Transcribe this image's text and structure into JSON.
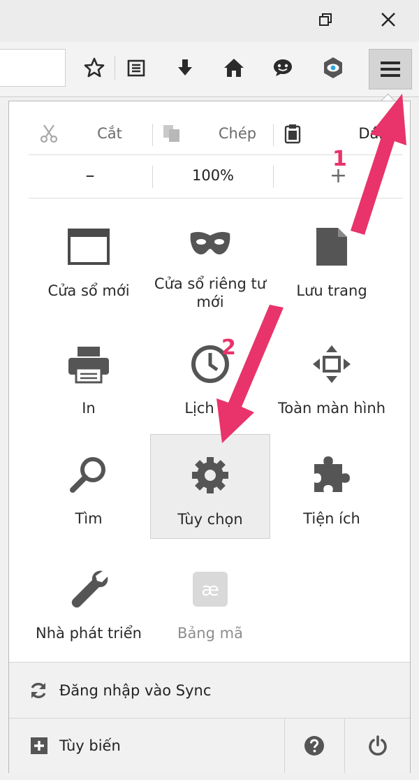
{
  "window": {
    "icons": [
      "restore-icon",
      "close-icon"
    ]
  },
  "toolbar": {
    "icons": [
      "bookmark-star-icon",
      "reading-list-icon",
      "download-icon",
      "home-icon",
      "chat-icon",
      "pocket-icon",
      "hamburger-menu-icon"
    ]
  },
  "menu": {
    "edit": {
      "cut": "Cắt",
      "copy": "Chép",
      "paste": "Dán"
    },
    "zoom": {
      "minus": "–",
      "level": "100%",
      "plus": "+"
    },
    "items": [
      {
        "label": "Cửa sổ mới",
        "icon": "new-window-icon"
      },
      {
        "label": "Cửa sổ riêng tư mới",
        "icon": "private-mask-icon"
      },
      {
        "label": "Lưu trang",
        "icon": "save-page-icon"
      },
      {
        "label": "In",
        "icon": "printer-icon"
      },
      {
        "label": "Lịch sử",
        "icon": "history-clock-icon"
      },
      {
        "label": "Toàn màn hình",
        "icon": "fullscreen-icon"
      },
      {
        "label": "Tìm",
        "icon": "search-icon"
      },
      {
        "label": "Tùy chọn",
        "icon": "gear-icon"
      },
      {
        "label": "Tiện ích",
        "icon": "puzzle-icon"
      },
      {
        "label": "Nhà phát triển",
        "icon": "wrench-icon"
      },
      {
        "label": "Bảng mã",
        "icon": "encoding-ae-icon"
      }
    ],
    "footer": {
      "sync": "Đăng nhập vào Sync",
      "customize": "Tùy biến"
    }
  },
  "annotations": {
    "step1": "1",
    "step2": "2",
    "accent": "#e8336b"
  }
}
